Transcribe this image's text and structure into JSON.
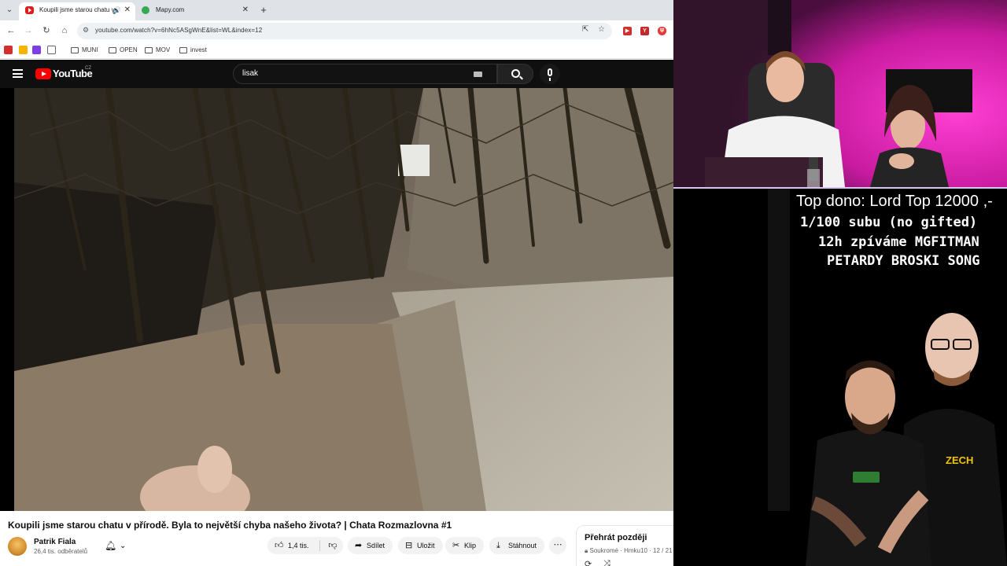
{
  "browser": {
    "tabs": [
      {
        "title": "Koupili jsme starou chatu v",
        "active": true
      },
      {
        "title": "Mapy.com",
        "active": false
      }
    ],
    "url": "youtube.com/watch?v=6hNc5ASgWnE&list=WL&index=12",
    "bookmarks": [
      "MUNI",
      "OPEN",
      "MOV",
      "invest"
    ]
  },
  "youtube": {
    "logo_text": "YouTube",
    "country_code": "CZ",
    "search_value": "lisak",
    "video": {
      "title": "Koupili jsme starou chatu v přírodě. Byla to největší chyba našeho života? | Chata Rozmazlovna #1",
      "channel": "Patrik Fiala",
      "subscribers": "26,4 tis. odběratelů",
      "likes": "1,4 tis.",
      "actions": {
        "share": "Sdílet",
        "save": "Uložit",
        "clip": "Klip",
        "download": "Stáhnout"
      }
    },
    "playlist": {
      "title": "Přehrát později",
      "privacy": "Soukromé",
      "owner": "Hmku10",
      "position": "12 / 21"
    }
  },
  "overlay": {
    "line1": "Top dono: Lord Top 12000 ,-",
    "line2": "1/100 subu (no gifted)",
    "line3": "12h zpíváme MGFITMAN",
    "line4": "PETARDY BROSKI SONG",
    "shirt_logo": "ZECH"
  },
  "colors": {
    "youtube_red": "#ff0000",
    "yt_dark": "#0f0f0f",
    "webcam_pink": "#e81fb6"
  }
}
